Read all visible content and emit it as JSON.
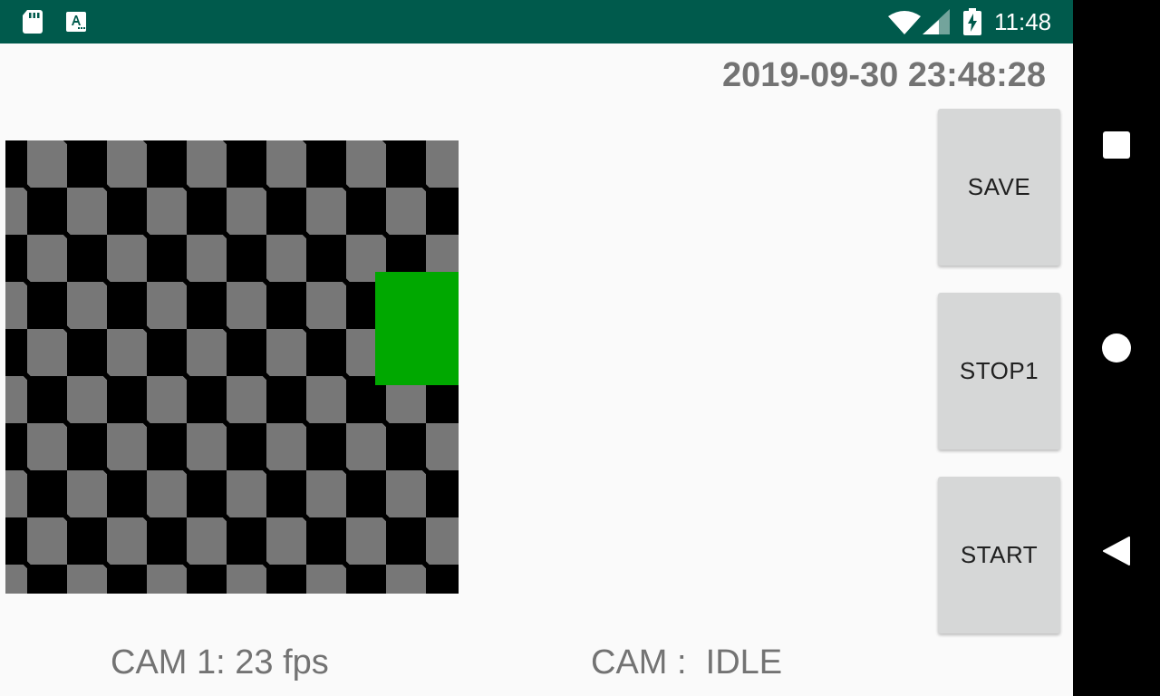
{
  "status_bar": {
    "time": "11:48",
    "background_color": "#005a4c",
    "icons": [
      "sd-card-icon",
      "text-a-icon",
      "wifi-icon",
      "cell-signal-icon",
      "battery-charging-icon"
    ]
  },
  "header": {
    "datetime": "2019-09-30 23:48:28"
  },
  "preview": {
    "pattern": "checkerboard",
    "colors": [
      "#000000",
      "#777777"
    ],
    "overlay_color": "#00a800"
  },
  "buttons": {
    "save_label": "SAVE",
    "stop_label": "STOP1",
    "start_label": "START"
  },
  "footer": {
    "cam1_status": "CAM 1: 23 fps",
    "cam_state": "CAM :  IDLE"
  },
  "nav_bar": {
    "icons": [
      "recents-square-icon",
      "home-circle-icon",
      "back-triangle-icon"
    ]
  }
}
